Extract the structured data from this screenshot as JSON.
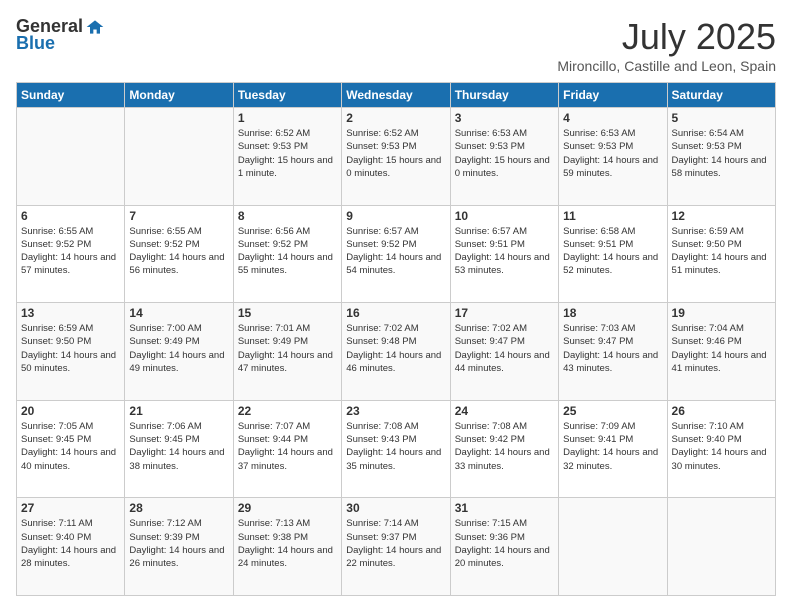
{
  "header": {
    "logo_general": "General",
    "logo_blue": "Blue",
    "month_title": "July 2025",
    "location": "Mironcillo, Castille and Leon, Spain"
  },
  "days_of_week": [
    "Sunday",
    "Monday",
    "Tuesday",
    "Wednesday",
    "Thursday",
    "Friday",
    "Saturday"
  ],
  "weeks": [
    [
      {
        "day": "",
        "content": ""
      },
      {
        "day": "",
        "content": ""
      },
      {
        "day": "1",
        "content": "Sunrise: 6:52 AM\nSunset: 9:53 PM\nDaylight: 15 hours and 1 minute."
      },
      {
        "day": "2",
        "content": "Sunrise: 6:52 AM\nSunset: 9:53 PM\nDaylight: 15 hours and 0 minutes."
      },
      {
        "day": "3",
        "content": "Sunrise: 6:53 AM\nSunset: 9:53 PM\nDaylight: 15 hours and 0 minutes."
      },
      {
        "day": "4",
        "content": "Sunrise: 6:53 AM\nSunset: 9:53 PM\nDaylight: 14 hours and 59 minutes."
      },
      {
        "day": "5",
        "content": "Sunrise: 6:54 AM\nSunset: 9:53 PM\nDaylight: 14 hours and 58 minutes."
      }
    ],
    [
      {
        "day": "6",
        "content": "Sunrise: 6:55 AM\nSunset: 9:52 PM\nDaylight: 14 hours and 57 minutes."
      },
      {
        "day": "7",
        "content": "Sunrise: 6:55 AM\nSunset: 9:52 PM\nDaylight: 14 hours and 56 minutes."
      },
      {
        "day": "8",
        "content": "Sunrise: 6:56 AM\nSunset: 9:52 PM\nDaylight: 14 hours and 55 minutes."
      },
      {
        "day": "9",
        "content": "Sunrise: 6:57 AM\nSunset: 9:52 PM\nDaylight: 14 hours and 54 minutes."
      },
      {
        "day": "10",
        "content": "Sunrise: 6:57 AM\nSunset: 9:51 PM\nDaylight: 14 hours and 53 minutes."
      },
      {
        "day": "11",
        "content": "Sunrise: 6:58 AM\nSunset: 9:51 PM\nDaylight: 14 hours and 52 minutes."
      },
      {
        "day": "12",
        "content": "Sunrise: 6:59 AM\nSunset: 9:50 PM\nDaylight: 14 hours and 51 minutes."
      }
    ],
    [
      {
        "day": "13",
        "content": "Sunrise: 6:59 AM\nSunset: 9:50 PM\nDaylight: 14 hours and 50 minutes."
      },
      {
        "day": "14",
        "content": "Sunrise: 7:00 AM\nSunset: 9:49 PM\nDaylight: 14 hours and 49 minutes."
      },
      {
        "day": "15",
        "content": "Sunrise: 7:01 AM\nSunset: 9:49 PM\nDaylight: 14 hours and 47 minutes."
      },
      {
        "day": "16",
        "content": "Sunrise: 7:02 AM\nSunset: 9:48 PM\nDaylight: 14 hours and 46 minutes."
      },
      {
        "day": "17",
        "content": "Sunrise: 7:02 AM\nSunset: 9:47 PM\nDaylight: 14 hours and 44 minutes."
      },
      {
        "day": "18",
        "content": "Sunrise: 7:03 AM\nSunset: 9:47 PM\nDaylight: 14 hours and 43 minutes."
      },
      {
        "day": "19",
        "content": "Sunrise: 7:04 AM\nSunset: 9:46 PM\nDaylight: 14 hours and 41 minutes."
      }
    ],
    [
      {
        "day": "20",
        "content": "Sunrise: 7:05 AM\nSunset: 9:45 PM\nDaylight: 14 hours and 40 minutes."
      },
      {
        "day": "21",
        "content": "Sunrise: 7:06 AM\nSunset: 9:45 PM\nDaylight: 14 hours and 38 minutes."
      },
      {
        "day": "22",
        "content": "Sunrise: 7:07 AM\nSunset: 9:44 PM\nDaylight: 14 hours and 37 minutes."
      },
      {
        "day": "23",
        "content": "Sunrise: 7:08 AM\nSunset: 9:43 PM\nDaylight: 14 hours and 35 minutes."
      },
      {
        "day": "24",
        "content": "Sunrise: 7:08 AM\nSunset: 9:42 PM\nDaylight: 14 hours and 33 minutes."
      },
      {
        "day": "25",
        "content": "Sunrise: 7:09 AM\nSunset: 9:41 PM\nDaylight: 14 hours and 32 minutes."
      },
      {
        "day": "26",
        "content": "Sunrise: 7:10 AM\nSunset: 9:40 PM\nDaylight: 14 hours and 30 minutes."
      }
    ],
    [
      {
        "day": "27",
        "content": "Sunrise: 7:11 AM\nSunset: 9:40 PM\nDaylight: 14 hours and 28 minutes."
      },
      {
        "day": "28",
        "content": "Sunrise: 7:12 AM\nSunset: 9:39 PM\nDaylight: 14 hours and 26 minutes."
      },
      {
        "day": "29",
        "content": "Sunrise: 7:13 AM\nSunset: 9:38 PM\nDaylight: 14 hours and 24 minutes."
      },
      {
        "day": "30",
        "content": "Sunrise: 7:14 AM\nSunset: 9:37 PM\nDaylight: 14 hours and 22 minutes."
      },
      {
        "day": "31",
        "content": "Sunrise: 7:15 AM\nSunset: 9:36 PM\nDaylight: 14 hours and 20 minutes."
      },
      {
        "day": "",
        "content": ""
      },
      {
        "day": "",
        "content": ""
      }
    ]
  ]
}
